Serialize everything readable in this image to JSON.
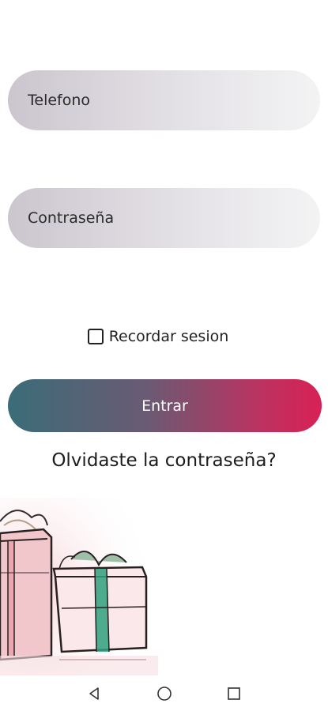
{
  "form": {
    "phone_placeholder": "Telefono",
    "password_placeholder": "Contraseña",
    "remember_label": "Recordar sesion",
    "remember_checked": false,
    "login_label": "Entrar",
    "forgot_label": "Olvidaste la contraseña?"
  },
  "colors": {
    "button_start": "#3b6c78",
    "button_end": "#d82155",
    "field_bg": "#cbc6ce"
  },
  "navbar": {
    "icons": [
      "back-icon",
      "home-icon",
      "recents-icon"
    ]
  }
}
